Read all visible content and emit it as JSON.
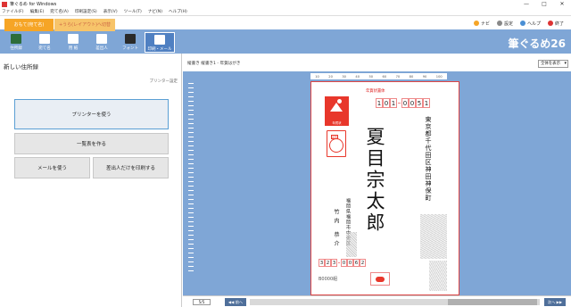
{
  "window": {
    "title": "筆ぐるめ for Windows",
    "controls": [
      "—",
      "□",
      "✕"
    ]
  },
  "menu": [
    "ファイル(F)",
    "編集(E)",
    "宛て名(A)",
    "印刷設定(S)",
    "表示(V)",
    "ツール(T)",
    "ナビ(N)",
    "ヘルプ(H)"
  ],
  "tabs": {
    "tab1": "おもて(宛て名)",
    "tab2": "+うら(レイアウト)へ切替"
  },
  "links": {
    "navi": "ナビ",
    "settings": "設定",
    "help": "ヘルプ",
    "close": "終了"
  },
  "toolbar": [
    "住所録",
    "宛て名",
    "用 紙",
    "差出人",
    "フォント",
    "印刷・メール"
  ],
  "brand": "筆ぐるめ26",
  "left": {
    "heading": "新しい住所録",
    "printer_settings": "プリンター設定",
    "btn_use_printer": "プリンターを使う",
    "btn_make_list": "一覧表を作る",
    "btn_use_mail": "メールを使う",
    "btn_print_sender": "差出人だけを印刷する"
  },
  "preview": {
    "crumb": "縦書き 縦書き1 - 年賀はがき",
    "view_select": "全体を表示",
    "ruler": [
      "10",
      "20",
      "30",
      "40",
      "50",
      "60",
      "70",
      "80",
      "90",
      "100"
    ],
    "size_hint": "年賀状書体",
    "zip": [
      "1",
      "0",
      "1",
      "0",
      "0",
      "5",
      "1"
    ],
    "name": "夏目宗太郎",
    "address": "東京都千代田区神田神保町",
    "sender_address": "福岡県福岡市中央区",
    "sender_name": "竹内 恭介",
    "sender_zip": [
      "3",
      "2",
      "3",
      "0",
      "0",
      "6",
      "2"
    ],
    "stamp_label": "年賀状",
    "postmark_label": "年賀",
    "bottom_nums": "B0000組",
    "page": "5/5",
    "prev": "◀◀ 前へ",
    "next": "次へ ▶▶"
  },
  "colors": {
    "accent": "#7fa6d6",
    "tab": "#f6a526",
    "stamp": "#e8372b"
  }
}
